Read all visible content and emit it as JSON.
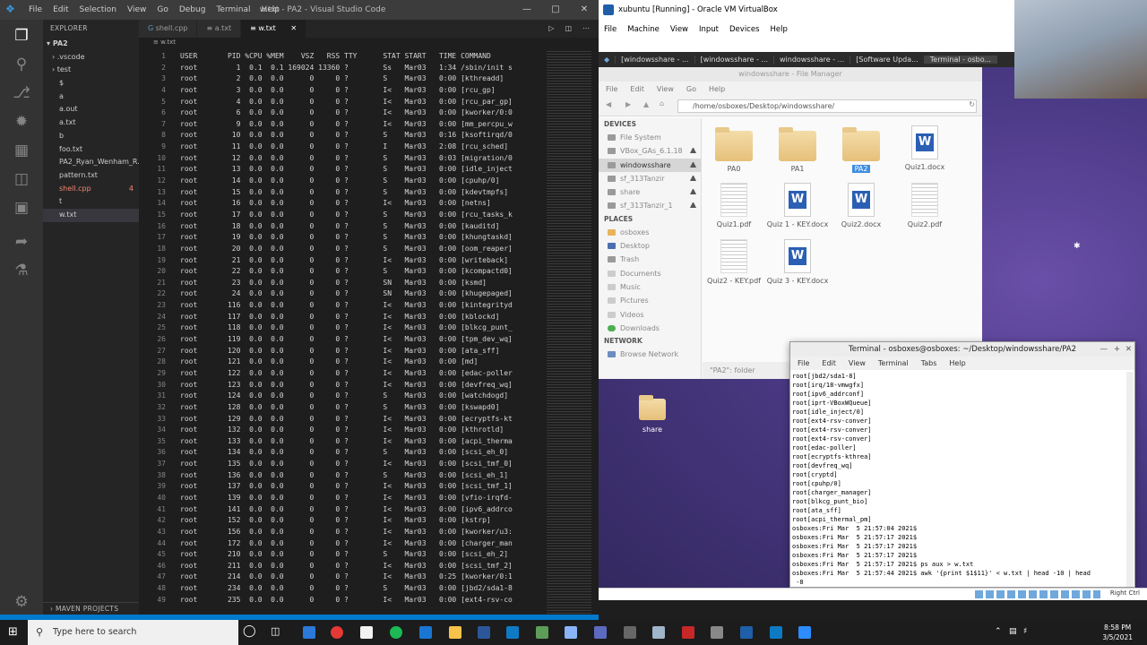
{
  "vscode": {
    "menu": [
      "File",
      "Edit",
      "Selection",
      "View",
      "Go",
      "Debug",
      "Terminal",
      "Help"
    ],
    "title": "w.txt - PA2 - Visual Studio Code",
    "explorer_label": "EXPLORER",
    "root": "PA2",
    "files": [
      ".vscode",
      "test",
      "$",
      "a",
      "a.out",
      "a.txt",
      "b",
      "foo.txt",
      "PA2_Ryan_Wenham_R...",
      "pattern.txt",
      "shell.cpp",
      "t",
      "w.txt"
    ],
    "error_count": "4",
    "maven_label": "MAVEN PROJECTS",
    "tabs": [
      "shell.cpp",
      "a.txt",
      "w.txt"
    ],
    "breadcrumb": "w.txt",
    "lines": [
      "USER       PID %CPU %MEM    VSZ   RSS TTY      STAT START   TIME COMMAND",
      "root         1  0.1  0.1 169024 13360 ?        Ss   Mar03   1:34 /sbin/init s",
      "root         2  0.0  0.0      0     0 ?        S    Mar03   0:00 [kthreadd]",
      "root         3  0.0  0.0      0     0 ?        I<   Mar03   0:00 [rcu_gp]",
      "root         4  0.0  0.0      0     0 ?        I<   Mar03   0:00 [rcu_par_gp]",
      "root         6  0.0  0.0      0     0 ?        I<   Mar03   0:00 [kworker/0:0",
      "root         9  0.0  0.0      0     0 ?        I<   Mar03   0:00 [mm_percpu_w",
      "root        10  0.0  0.0      0     0 ?        S    Mar03   0:16 [ksoftirqd/0",
      "root        11  0.0  0.0      0     0 ?        I    Mar03   2:08 [rcu_sched]",
      "root        12  0.0  0.0      0     0 ?        S    Mar03   0:03 [migration/0",
      "root        13  0.0  0.0      0     0 ?        S    Mar03   0:00 [idle_inject",
      "root        14  0.0  0.0      0     0 ?        S    Mar03   0:00 [cpuhp/0]",
      "root        15  0.0  0.0      0     0 ?        S    Mar03   0:00 [kdevtmpfs]",
      "root        16  0.0  0.0      0     0 ?        I<   Mar03   0:00 [netns]",
      "root        17  0.0  0.0      0     0 ?        S    Mar03   0:00 [rcu_tasks_k",
      "root        18  0.0  0.0      0     0 ?        S    Mar03   0:00 [kauditd]",
      "root        19  0.0  0.0      0     0 ?        S    Mar03   0:00 [khungtaskd]",
      "root        20  0.0  0.0      0     0 ?        S    Mar03   0:00 [oom_reaper]",
      "root        21  0.0  0.0      0     0 ?        I<   Mar03   0:00 [writeback]",
      "root        22  0.0  0.0      0     0 ?        S    Mar03   0:00 [kcompactd0]",
      "root        23  0.0  0.0      0     0 ?        SN   Mar03   0:00 [ksmd]",
      "root        24  0.0  0.0      0     0 ?        SN   Mar03   0:00 [khugepaged]",
      "root       116  0.0  0.0      0     0 ?        I<   Mar03   0:00 [kintegrityd",
      "root       117  0.0  0.0      0     0 ?        I<   Mar03   0:00 [kblockd]",
      "root       118  0.0  0.0      0     0 ?        I<   Mar03   0:00 [blkcg_punt_",
      "root       119  0.0  0.0      0     0 ?        I<   Mar03   0:00 [tpm_dev_wq]",
      "root       120  0.0  0.0      0     0 ?        I<   Mar03   0:00 [ata_sff]",
      "root       121  0.0  0.0      0     0 ?        I<   Mar03   0:00 [md]",
      "root       122  0.0  0.0      0     0 ?        I<   Mar03   0:00 [edac-poller",
      "root       123  0.0  0.0      0     0 ?        I<   Mar03   0:00 [devfreq_wq]",
      "root       124  0.0  0.0      0     0 ?        S    Mar03   0:00 [watchdogd]",
      "root       128  0.0  0.0      0     0 ?        S    Mar03   0:00 [kswapd0]",
      "root       129  0.0  0.0      0     0 ?        I<   Mar03   0:00 [ecryptfs-kt",
      "root       132  0.0  0.0      0     0 ?        I<   Mar03   0:00 [kthrotld]",
      "root       133  0.0  0.0      0     0 ?        I<   Mar03   0:00 [acpi_therma",
      "root       134  0.0  0.0      0     0 ?        S    Mar03   0:00 [scsi_eh_0]",
      "root       135  0.0  0.0      0     0 ?        I<   Mar03   0:00 [scsi_tmf_0]",
      "root       136  0.0  0.0      0     0 ?        S    Mar03   0:00 [scsi_eh_1]",
      "root       137  0.0  0.0      0     0 ?        I<   Mar03   0:00 [scsi_tmf_1]",
      "root       139  0.0  0.0      0     0 ?        I<   Mar03   0:00 [vfio-irqfd-",
      "root       141  0.0  0.0      0     0 ?        I<   Mar03   0:00 [ipv6_addrco",
      "root       152  0.0  0.0      0     0 ?        I<   Mar03   0:00 [kstrp]",
      "root       156  0.0  0.0      0     0 ?        I<   Mar03   0:00 [kworker/u3:",
      "root       172  0.0  0.0      0     0 ?        I<   Mar03   0:00 [charger_man",
      "root       210  0.0  0.0      0     0 ?        S    Mar03   0:00 [scsi_eh_2]",
      "root       211  0.0  0.0      0     0 ?        I<   Mar03   0:00 [scsi_tmf_2]",
      "root       214  0.0  0.0      0     0 ?        I<   Mar03   0:25 [kworker/0:1",
      "root       234  0.0  0.0      0     0 ?        S    Mar03   0:00 [jbd2/sda1-8",
      "root       235  0.0  0.0      0     0 ?        I<   Mar03   0:00 [ext4-rsv-co"
    ]
  },
  "vbox": {
    "title": "xubuntu [Running] - Oracle VM VirtualBox",
    "menu": [
      "File",
      "Machine",
      "View",
      "Input",
      "Devices",
      "Help"
    ],
    "guest_tabs": [
      "[windowsshare - ...",
      "[windowsshare - ...",
      "windowsshare - ...",
      "[Software Upda...",
      "Terminal - osbo..."
    ],
    "right_ctrl": "Right Ctrl"
  },
  "file_manager": {
    "title": "windowsshare - File Manager",
    "menu": [
      "File",
      "Edit",
      "View",
      "Go",
      "Help"
    ],
    "path": "/home/osboxes/Desktop/windowsshare/",
    "devices_label": "DEVICES",
    "devices": [
      "File System",
      "VBox_GAs_6.1.18",
      "windowsshare",
      "sf_313Tanzir",
      "share",
      "sf_313Tanzir_1"
    ],
    "places_label": "PLACES",
    "places": [
      "osboxes",
      "Desktop",
      "Trash",
      "Documents",
      "Music",
      "Pictures",
      "Videos",
      "Downloads"
    ],
    "network_label": "NETWORK",
    "network": [
      "Browse Network"
    ],
    "items": [
      "PA0",
      "PA1",
      "PA2",
      "Quiz1.docx",
      "Quiz1.pdf",
      "Quiz 1 - KEY.docx",
      "Quiz2.docx",
      "Quiz2.pdf",
      "Quiz2 - KEY.pdf",
      "Quiz 3 - KEY.docx"
    ],
    "status": "\"PA2\": folder"
  },
  "desktop": {
    "share_label": "share"
  },
  "terminal": {
    "title": "Terminal - osboxes@osboxes: ~/Desktop/windowsshare/PA2",
    "menu": [
      "File",
      "Edit",
      "View",
      "Terminal",
      "Tabs",
      "Help"
    ],
    "lines": [
      "root[jbd2/sda1-8]",
      "root[irq/18-vmwgfx]",
      "root[ipv6_addrconf]",
      "root[iprt-VBoxWQueue]",
      "root[idle_inject/0]",
      "root[ext4-rsv-conver]",
      "root[ext4-rsv-conver]",
      "root[ext4-rsv-conver]",
      "root[edac-poller]",
      "root[ecryptfs-kthrea]",
      "root[devfreq_wq]",
      "root[cryptd]",
      "root[cpuhp/0]",
      "root[charger_manager]",
      "root[blkcg_punt_bio]",
      "root[ata_sff]",
      "root[acpi_thermal_pm]",
      "osboxes:Fri Mar  5 21:57:04 2021$",
      "osboxes:Fri Mar  5 21:57:17 2021$",
      "osboxes:Fri Mar  5 21:57:17 2021$",
      "osboxes:Fri Mar  5 21:57:17 2021$",
      "osboxes:Fri Mar  5 21:57:17 2021$ ps aux > w.txt",
      "osboxes:Fri Mar  5 21:57:44 2021$ awk '{print $1$11}' < w.txt | head -10 | head",
      " -8"
    ]
  },
  "taskbar": {
    "search_placeholder": "Type here to search",
    "time": "8:58 PM",
    "date": "3/5/2021"
  }
}
